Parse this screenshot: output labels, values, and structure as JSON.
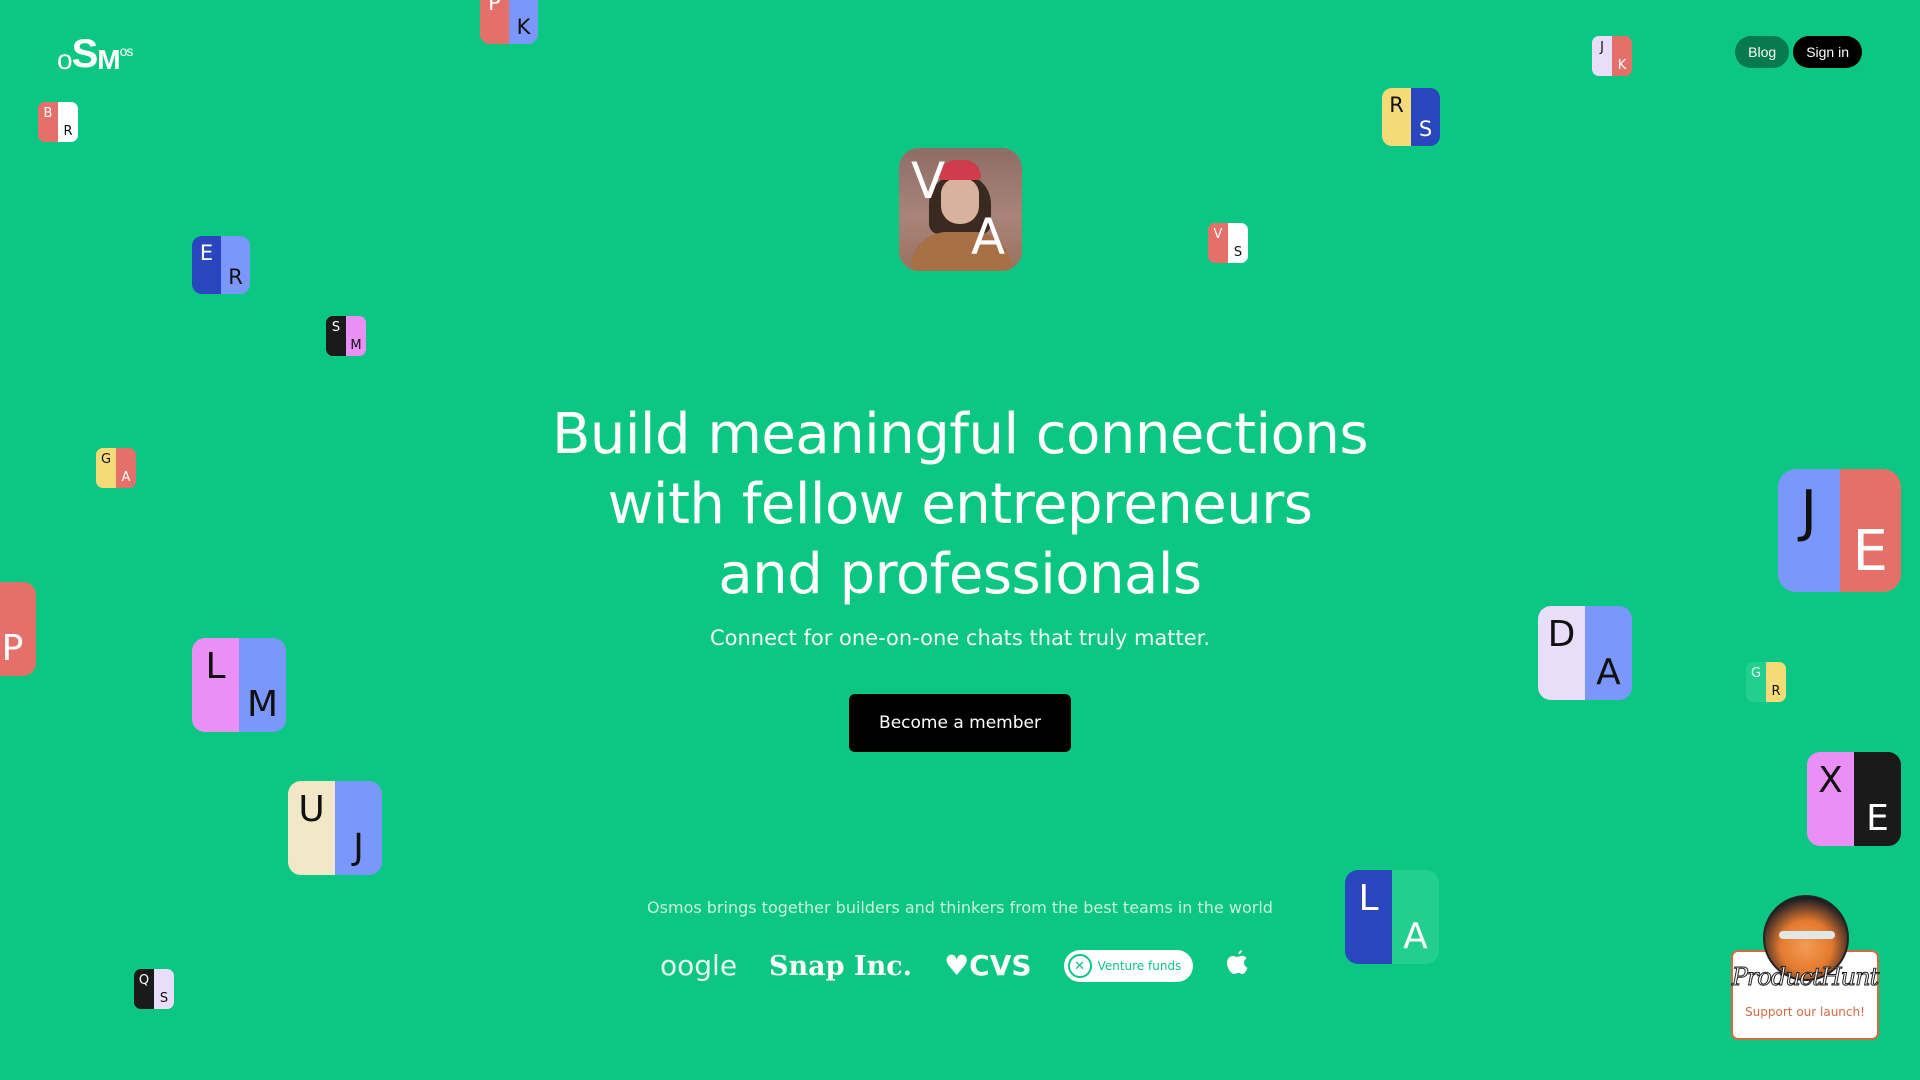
{
  "brand": {
    "logo_parts": [
      "o",
      "S",
      "M",
      "os"
    ],
    "name": "Osmos"
  },
  "nav": {
    "blog": "Blog",
    "sign_in": "Sign in"
  },
  "hero": {
    "headline_lines": [
      "Build meaningful connections",
      "with fellow entrepreneurs",
      "and professionals"
    ],
    "subtitle": "Connect for one-on-one chats that truly matter.",
    "cta": "Become a member"
  },
  "teams": {
    "caption": "Osmos brings together builders and thinkers from the best teams in the world",
    "logos": {
      "google": "oogle",
      "snap": "Snap Inc.",
      "cvs": "♥CVS",
      "venture": "Venture funds",
      "venture_icon": "✕",
      "apple": ""
    }
  },
  "product_hunt": {
    "script": "ProductHunt",
    "support": "Support our launch!"
  },
  "avatar_card": {
    "top": "V",
    "bottom": "A"
  },
  "cards": [
    {
      "id": "pk",
      "top": "P",
      "bottom": "K",
      "left": "#e5706a",
      "right": "#7b97fb",
      "lt": "#fff",
      "rt": "#111"
    },
    {
      "id": "br",
      "top": "B",
      "bottom": "R",
      "left": "#e5706a",
      "right": "#ffffff",
      "lt": "#fff",
      "rt": "#111"
    },
    {
      "id": "jk",
      "top": "J",
      "bottom": "K",
      "left": "#e9def9",
      "right": "#e5706a",
      "lt": "#111",
      "rt": "#fff"
    },
    {
      "id": "rs",
      "top": "R",
      "bottom": "S",
      "left": "#f4db77",
      "right": "#2a46bf",
      "lt": "#111",
      "rt": "#fff"
    },
    {
      "id": "vs",
      "top": "V",
      "bottom": "S",
      "left": "#e5706a",
      "right": "#ffffff",
      "lt": "#fff",
      "rt": "#111"
    },
    {
      "id": "er",
      "top": "E",
      "bottom": "R",
      "left": "#2a46bf",
      "right": "#7b97fb",
      "lt": "#fff",
      "rt": "#111"
    },
    {
      "id": "sm",
      "top": "S",
      "bottom": "M",
      "left": "#1a1a1a",
      "right": "#e98ff5",
      "lt": "#fff",
      "rt": "#111"
    },
    {
      "id": "ga",
      "top": "G",
      "bottom": "A",
      "left": "#f4db77",
      "right": "#e5706a",
      "lt": "#111",
      "rt": "#fff"
    },
    {
      "id": "p",
      "top": "",
      "bottom": "P",
      "left": "#e5706a",
      "right": "#e5706a",
      "lt": "#fff",
      "rt": "#fff"
    },
    {
      "id": "lm",
      "top": "L",
      "bottom": "M",
      "left": "#e98ff5",
      "right": "#7b97fb",
      "lt": "#111",
      "rt": "#111"
    },
    {
      "id": "uj",
      "top": "U",
      "bottom": "J",
      "left": "#f2e8c7",
      "right": "#7b97fb",
      "lt": "#111",
      "rt": "#111"
    },
    {
      "id": "qs",
      "top": "Q",
      "bottom": "S",
      "left": "#1a1a1a",
      "right": "#e9def9",
      "lt": "#fff",
      "rt": "#111"
    },
    {
      "id": "je",
      "top": "J",
      "bottom": "E",
      "left": "#7b97fb",
      "right": "#e5706a",
      "lt": "#111",
      "rt": "#fff"
    },
    {
      "id": "da",
      "top": "D",
      "bottom": "A",
      "left": "#e9def9",
      "right": "#7b97fb",
      "lt": "#111",
      "rt": "#111"
    },
    {
      "id": "gr",
      "top": "G",
      "bottom": "R",
      "left": "#22cf8f",
      "right": "#f4db77",
      "lt": "#e9fff5",
      "rt": "#111"
    },
    {
      "id": "xe",
      "top": "X",
      "bottom": "E",
      "left": "#e98ff5",
      "right": "#1a1a1a",
      "lt": "#111",
      "rt": "#fff"
    },
    {
      "id": "la",
      "top": "L",
      "bottom": "A",
      "left": "#2a46bf",
      "right": "#22cf8f",
      "lt": "#fff",
      "rt": "#fff"
    }
  ],
  "colors": {
    "background": "#0cc683",
    "cta": "#000000",
    "blog_pill": "#077a4f",
    "product_hunt_accent": "#d46a44"
  }
}
